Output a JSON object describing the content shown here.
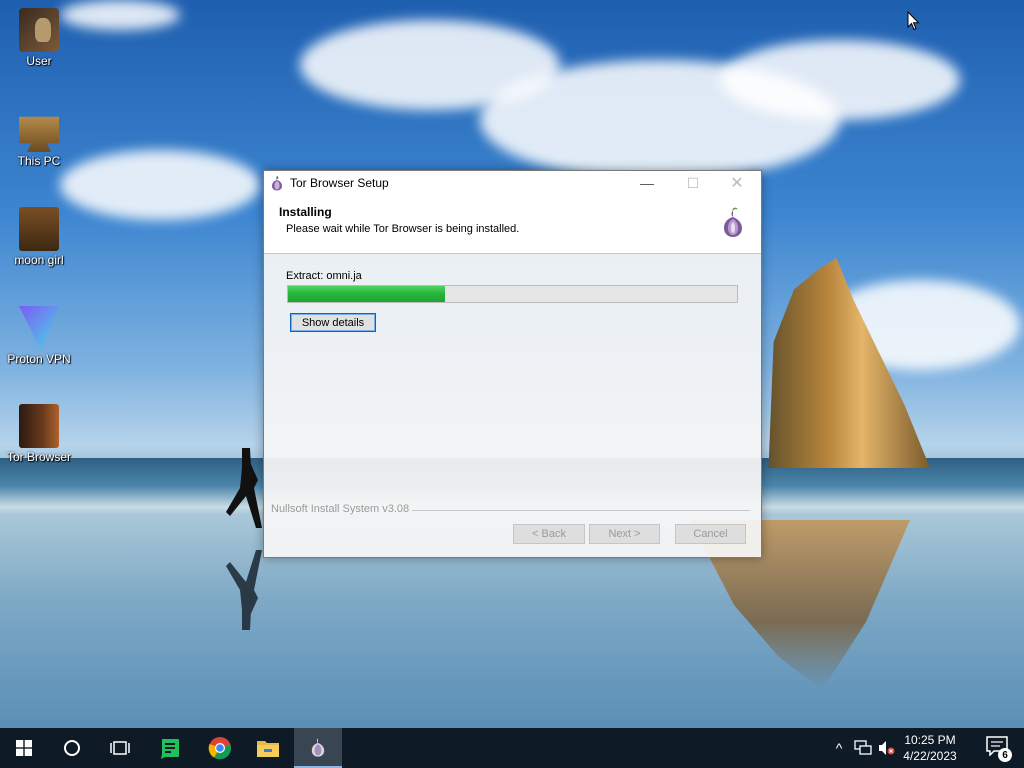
{
  "desktop": {
    "icons": [
      {
        "label": "User"
      },
      {
        "label": "This PC"
      },
      {
        "label": "moon girl"
      },
      {
        "label": "Proton VPN"
      },
      {
        "label": "Tor Browser"
      }
    ]
  },
  "window": {
    "title": "Tor Browser Setup",
    "header_title": "Installing",
    "header_subtitle": "Please wait while Tor Browser is being installed.",
    "status_text": "Extract: omni.ja",
    "progress_fraction": 0.35,
    "show_details_label": "Show details",
    "brand_text": "Nullsoft Install System v3.08",
    "back_label": "< Back",
    "next_label": "Next >",
    "cancel_label": "Cancel"
  },
  "taskbar": {
    "time": "10:25 PM",
    "date": "4/22/2023",
    "notification_count": "6",
    "pinned": [
      {
        "icon": "windows-start-icon"
      },
      {
        "icon": "cortana-search-icon"
      },
      {
        "icon": "task-view-icon"
      },
      {
        "icon": "green-notes-app-icon"
      },
      {
        "icon": "chrome-icon"
      },
      {
        "icon": "file-explorer-icon"
      },
      {
        "icon": "tor-browser-icon"
      }
    ]
  },
  "colors": {
    "progress_fill": "#27b43c",
    "taskbar_bg": "#0f1a27",
    "focus_border": "#0b63c4"
  }
}
